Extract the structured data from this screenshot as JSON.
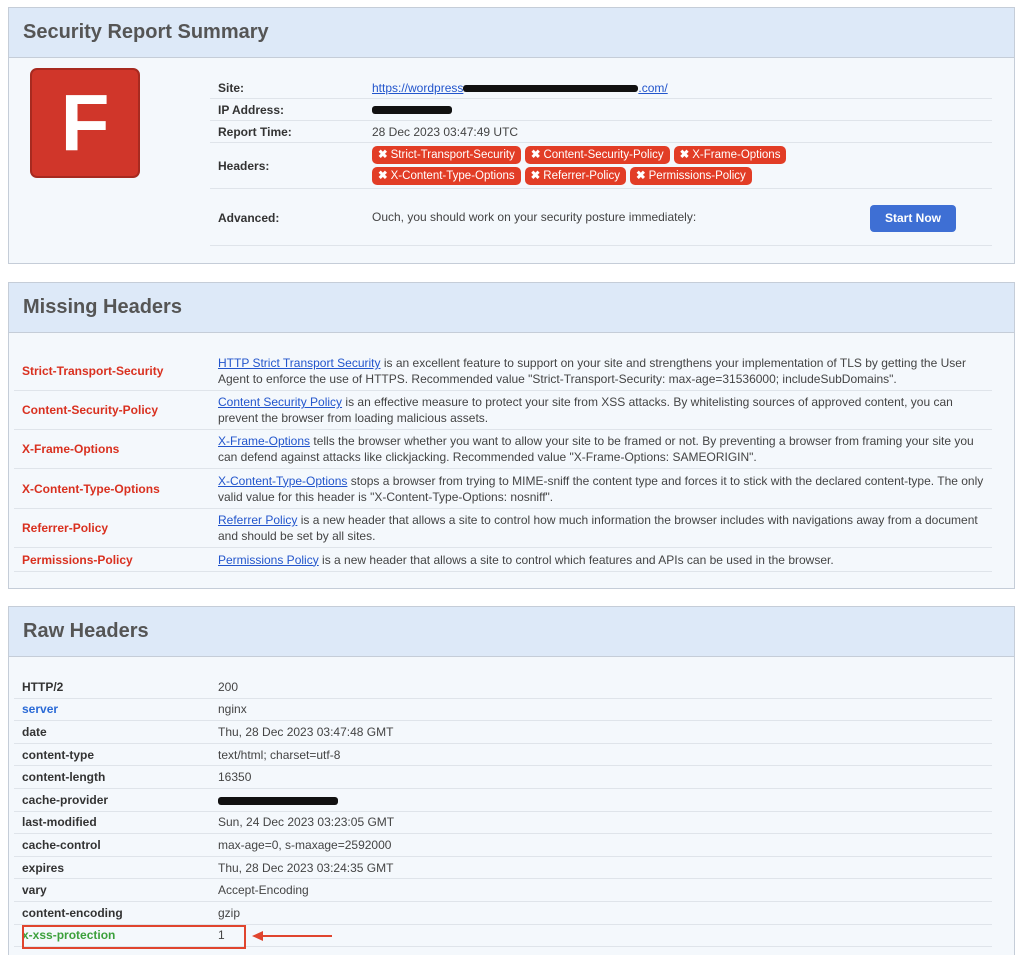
{
  "summary": {
    "title": "Security Report Summary",
    "grade": "F",
    "site_label": "Site:",
    "site_prefix": "https://wordpress",
    "site_suffix": ".com/",
    "ip_label": "IP Address:",
    "time_label": "Report Time:",
    "time_value": "28 Dec 2023 03:47:49 UTC",
    "headers_label": "Headers:",
    "headers": [
      "Strict-Transport-Security",
      "Content-Security-Policy",
      "X-Frame-Options",
      "X-Content-Type-Options",
      "Referrer-Policy",
      "Permissions-Policy"
    ],
    "advanced_label": "Advanced:",
    "advanced_text": "Ouch, you should work on your security posture immediately:",
    "start_button": "Start Now",
    "badge_color": "#e23d26",
    "grade_color": "#d0362a"
  },
  "missing": {
    "title": "Missing Headers",
    "rows": [
      {
        "name": "Strict-Transport-Security",
        "link": "HTTP Strict Transport Security",
        "text": " is an excellent feature to support on your site and strengthens your implementation of TLS by getting the User Agent to enforce the use of HTTPS. Recommended value \"Strict-Transport-Security: max-age=31536000; includeSubDomains\"."
      },
      {
        "name": "Content-Security-Policy",
        "link": "Content Security Policy",
        "text": " is an effective measure to protect your site from XSS attacks. By whitelisting sources of approved content, you can prevent the browser from loading malicious assets."
      },
      {
        "name": "X-Frame-Options",
        "link": "X-Frame-Options",
        "text": " tells the browser whether you want to allow your site to be framed or not. By preventing a browser from framing your site you can defend against attacks like clickjacking. Recommended value \"X-Frame-Options: SAMEORIGIN\"."
      },
      {
        "name": "X-Content-Type-Options",
        "link": "X-Content-Type-Options",
        "text": " stops a browser from trying to MIME-sniff the content type and forces it to stick with the declared content-type. The only valid value for this header is \"X-Content-Type-Options: nosniff\"."
      },
      {
        "name": "Referrer-Policy",
        "link": "Referrer Policy",
        "text": " is a new header that allows a site to control how much information the browser includes with navigations away from a document and should be set by all sites."
      },
      {
        "name": "Permissions-Policy",
        "link": "Permissions Policy",
        "text": " is a new header that allows a site to control which features and APIs can be used in the browser."
      }
    ]
  },
  "raw": {
    "title": "Raw Headers",
    "rows": [
      {
        "key": "HTTP/2",
        "value": "200",
        "color": "default"
      },
      {
        "key": "server",
        "value": "nginx",
        "color": "blue"
      },
      {
        "key": "date",
        "value": "Thu, 28 Dec 2023 03:47:48 GMT",
        "color": "default"
      },
      {
        "key": "content-type",
        "value": "text/html; charset=utf-8",
        "color": "default"
      },
      {
        "key": "content-length",
        "value": "16350",
        "color": "default"
      },
      {
        "key": "cache-provider",
        "value": "",
        "color": "default"
      },
      {
        "key": "last-modified",
        "value": "Sun, 24 Dec 2023 03:23:05 GMT",
        "color": "default"
      },
      {
        "key": "cache-control",
        "value": "max-age=0, s-maxage=2592000",
        "color": "default"
      },
      {
        "key": "expires",
        "value": "Thu, 28 Dec 2023 03:24:35 GMT",
        "color": "default"
      },
      {
        "key": "vary",
        "value": "Accept-Encoding",
        "color": "default"
      },
      {
        "key": "content-encoding",
        "value": "gzip",
        "color": "default"
      },
      {
        "key": "x-xss-protection",
        "value": "1",
        "color": "green"
      }
    ]
  },
  "colors": {
    "missing_name": "#d9301f",
    "server_key": "#2a6ad6",
    "xss_key": "#3ca03c",
    "highlight": "#e0452e",
    "button": "#3e6fd4"
  }
}
